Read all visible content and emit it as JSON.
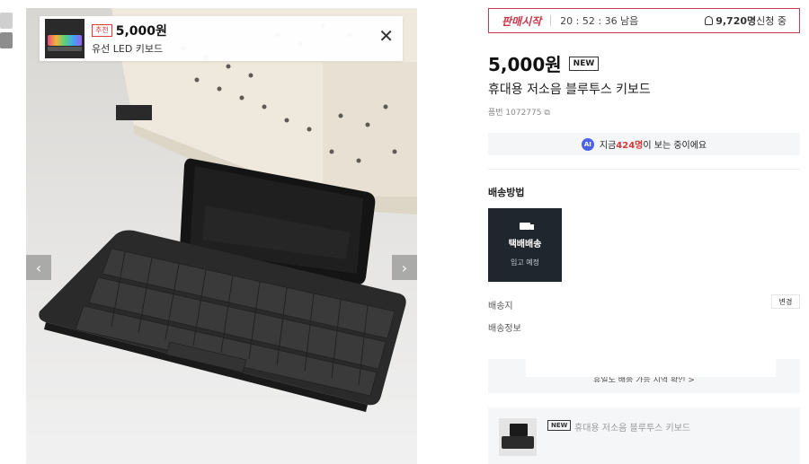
{
  "colors": {
    "accent_red": "#c8384b",
    "dark_card": "#1f262e",
    "ai_blue": "#4a63e8"
  },
  "gallery": {
    "prev_icon": "chevron-left-icon",
    "next_icon": "chevron-right-icon",
    "prev_glyph": "‹",
    "next_glyph": "›"
  },
  "recommend": {
    "badge": "추천",
    "price": "5,000원",
    "name": "유선 LED 키보드",
    "close_glyph": "✕"
  },
  "sale": {
    "label": "판매시작",
    "timer": "20 : 52 : 36 남음",
    "applicants": "9,720명",
    "applicants_suffix": " 신청 중"
  },
  "product": {
    "price": "5,000원",
    "badge": "NEW",
    "title": "휴대용 저소음 블루투스 키보드",
    "number": "품번 1072775 ⧉"
  },
  "viewing": {
    "ai": "AI",
    "prefix": "지금 ",
    "count": "424명",
    "suffix": "이 보는 중이에요"
  },
  "shipping": {
    "heading": "배송방법",
    "method_name": "택배배송",
    "method_sub": "입고 예정",
    "address_label": "배송지",
    "change_label": "변경",
    "info_label": "배송정보",
    "box_text": "휴일도 배송 가능 지역 확인 >"
  },
  "mini": {
    "badge": "NEW",
    "title": "휴대용 저소음 블루투스 키보드"
  }
}
